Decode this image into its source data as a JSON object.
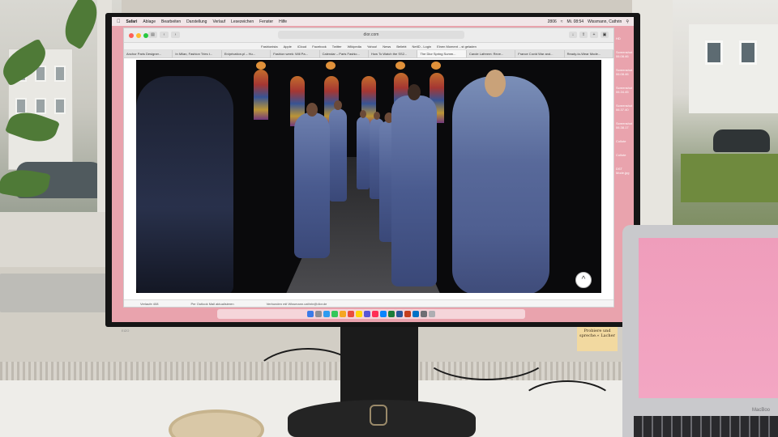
{
  "menubar": {
    "app": "Safari",
    "items": [
      "Ablage",
      "Bearbeiten",
      "Darstellung",
      "Verlauf",
      "Lesezeichen",
      "Fenster",
      "Hilfe"
    ],
    "status": "2806",
    "clock": "Mi. 08:54",
    "user": "Wissmann, Cathrin"
  },
  "browser": {
    "address": "dior.com",
    "favorites": [
      "Fashionista",
      "Apple",
      "iCloud",
      "Facebook",
      "Twitter",
      "Wikipedia",
      "Yahoo!",
      "News",
      "Beliebt",
      "NetID - Login",
      "Einen Moment ...st geladen"
    ],
    "tabs": [
      {
        "label": "Anchor Paris Designer..."
      },
      {
        "label": "In Milan, Fashion Tries t..."
      },
      {
        "label": "En/privation.pl – Hu..."
      },
      {
        "label": "Fashion week: Will Pa..."
      },
      {
        "label": "Calendar – Paris Fashio..."
      },
      {
        "label": "How To Watch the SS2..."
      },
      {
        "label": "The Dior Spring Summ..."
      },
      {
        "label": "Carole Lafreem: Reve..."
      },
      {
        "label": "France Covid War and..."
      },
      {
        "label": "Ready-to-Wear Mode..."
      }
    ],
    "status_left": "Verlaufe 408",
    "status_mid": "Per Outlook Mail aktualisieren",
    "status_right": "Verbunden mit Wissmann.cathrin@dior.de",
    "scroll_top": "^"
  },
  "desktop_sidebar": [
    {
      "label": "HD"
    },
    {
      "label": "Screenshot 06.08.46"
    },
    {
      "label": "Screenshot 06.08.46"
    },
    {
      "label": "Screenshot 06.34.45"
    },
    {
      "label": "Screenshot 06.37.40"
    },
    {
      "label": "Screenshot 06.38.17"
    },
    {
      "label": "Collote"
    },
    {
      "label": "Collote"
    },
    {
      "label": "DST Mode.jpg"
    }
  ],
  "sticky_note": "»Mein Motto ist: Probiere und spreche.« Lacher",
  "laptop_brand": "MacBoo",
  "monitor_logo": "EIZO",
  "colors": {
    "screen_bg": "#e9a3ad",
    "laptop_screen": "#f3a6c3",
    "traffic_red": "#fe5f57",
    "traffic_yellow": "#febc2e",
    "traffic_green": "#28c840"
  }
}
